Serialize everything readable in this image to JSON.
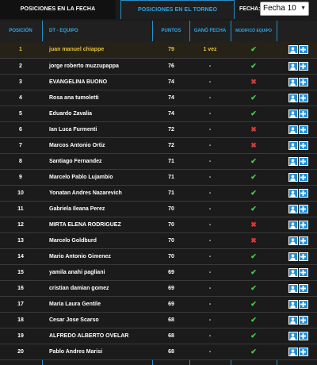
{
  "tabs": {
    "active_label": "POSICIONES EN LA FECHA",
    "inactive_label": "POSICIONES EN EL TORNEO"
  },
  "fecha": {
    "label": "FECHA:",
    "selected": "Fecha 10"
  },
  "columns": {
    "posicion": "POSICIÓN",
    "dt_equipo": "DT - EQUIPO",
    "puntos": "PUNTOS",
    "gano_fecha": "GANÓ FECHA",
    "modifico_equipo": "MODIFICÓ EQUIPO"
  },
  "colors": {
    "accent": "#2ea7e6",
    "highlight": "#e0c23a",
    "check": "#4ad04a",
    "cross": "#d33a3a",
    "button": "#1e8fd8"
  },
  "icons": {
    "check": "check-icon",
    "cross": "cross-icon",
    "user": "user-icon",
    "plus": "plus-icon"
  },
  "rows": [
    {
      "pos": "1",
      "name": "juan manuel chiappe",
      "pts": "79",
      "gano": "1 vez",
      "mod": "check"
    },
    {
      "pos": "2",
      "name": "jorge roberto muzzupappa",
      "pts": "76",
      "gano": "-",
      "mod": "check"
    },
    {
      "pos": "3",
      "name": "EVANGELINA BUONO",
      "pts": "74",
      "gano": "-",
      "mod": "cross"
    },
    {
      "pos": "4",
      "name": "Rosa ana tumoletti",
      "pts": "74",
      "gano": "-",
      "mod": "check"
    },
    {
      "pos": "5",
      "name": "Eduardo Zavalia",
      "pts": "74",
      "gano": "-",
      "mod": "check"
    },
    {
      "pos": "6",
      "name": "Ian Luca Furmenti",
      "pts": "72",
      "gano": "-",
      "mod": "cross"
    },
    {
      "pos": "7",
      "name": "Marcos Antonio Ortiz",
      "pts": "72",
      "gano": "-",
      "mod": "cross"
    },
    {
      "pos": "8",
      "name": "Santiago Fernandez",
      "pts": "71",
      "gano": "-",
      "mod": "check"
    },
    {
      "pos": "9",
      "name": "Marcelo Pablo Lujambio",
      "pts": "71",
      "gano": "-",
      "mod": "check"
    },
    {
      "pos": "10",
      "name": "Yonatan Andres Nazarevich",
      "pts": "71",
      "gano": "-",
      "mod": "check"
    },
    {
      "pos": "11",
      "name": "Gabriela Ileana Perez",
      "pts": "70",
      "gano": "-",
      "mod": "check"
    },
    {
      "pos": "12",
      "name": "MIRTA ELENA RODRIGUEZ",
      "pts": "70",
      "gano": "-",
      "mod": "cross"
    },
    {
      "pos": "13",
      "name": "Marcelo Goldburd",
      "pts": "70",
      "gano": "-",
      "mod": "cross"
    },
    {
      "pos": "14",
      "name": "Mario Antonio Gimenez",
      "pts": "70",
      "gano": "-",
      "mod": "check"
    },
    {
      "pos": "15",
      "name": "yamila anahi pagliani",
      "pts": "69",
      "gano": "-",
      "mod": "check"
    },
    {
      "pos": "16",
      "name": "cristian damian gomez",
      "pts": "69",
      "gano": "-",
      "mod": "check"
    },
    {
      "pos": "17",
      "name": "Maria Laura Gentile",
      "pts": "69",
      "gano": "-",
      "mod": "check"
    },
    {
      "pos": "18",
      "name": "Cesar Jose Scarso",
      "pts": "68",
      "gano": "-",
      "mod": "check"
    },
    {
      "pos": "19",
      "name": "ALFREDO ALBERTO OVELAR",
      "pts": "68",
      "gano": "-",
      "mod": "check"
    },
    {
      "pos": "20",
      "name": "Pablo Andres Marisi",
      "pts": "68",
      "gano": "-",
      "mod": "check"
    }
  ]
}
